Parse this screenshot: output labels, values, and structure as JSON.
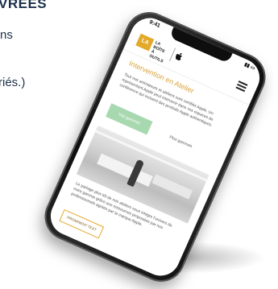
{
  "background": {
    "title": "VRÉES",
    "line1": "ns",
    "line2": "riés.)"
  },
  "status_bar": {
    "time": "9:41",
    "right": "▮▮ ▭"
  },
  "header": {
    "logo_box": "LA",
    "logo_text": "LA BOÎTE À OUTILS",
    "apple_icon": "apple-icon",
    "menu_icon": "menu-icon"
  },
  "hero": {
    "title": "Intervention en Atelier",
    "description": "Tout nos animateurs et ateliers sont certifiés Apple. Un représentant Apple peut intervenir dans vos espaces de conférence qui incluent des produits Apple authentiques.",
    "primary_button": "Voir gammes",
    "link_button": "Plus gammes"
  },
  "body": {
    "text": "Le partage plus tôt de nos ateliers vous intègre l'univers de votre gamme grâce aux ressources proposées par nos professionnels agréés par la marque Apple."
  },
  "cta_button": "PROMINENT TEXT",
  "colors": {
    "accent": "#e3a92a",
    "primary_button": "#a8d8b0",
    "background_text": "#1c2f4a"
  }
}
